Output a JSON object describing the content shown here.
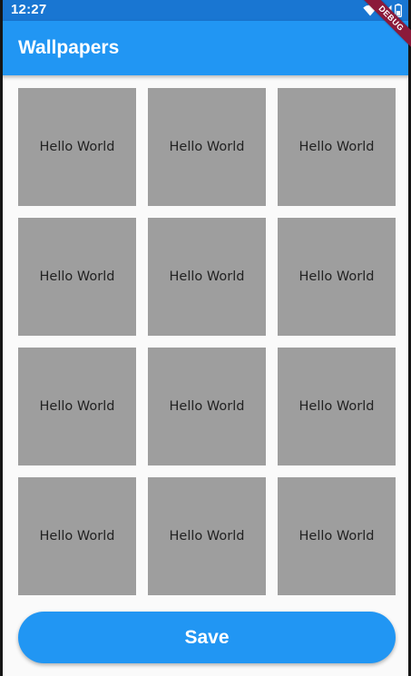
{
  "status_bar": {
    "time": "12:27",
    "icons": [
      "wifi-icon",
      "signal-icon",
      "battery-icon"
    ],
    "color": "#1976d2"
  },
  "app_bar": {
    "title": "Wallpapers",
    "color": "#2196f3"
  },
  "debug_banner": {
    "label": "DEBUG",
    "color": "#8b1a3a"
  },
  "grid": {
    "tile_color": "#9e9e9e",
    "items": [
      {
        "label": "Hello World"
      },
      {
        "label": "Hello World"
      },
      {
        "label": "Hello World"
      },
      {
        "label": "Hello World"
      },
      {
        "label": "Hello World"
      },
      {
        "label": "Hello World"
      },
      {
        "label": "Hello World"
      },
      {
        "label": "Hello World"
      },
      {
        "label": "Hello World"
      },
      {
        "label": "Hello World"
      },
      {
        "label": "Hello World"
      },
      {
        "label": "Hello World"
      }
    ]
  },
  "actions": {
    "save_label": "Save"
  }
}
